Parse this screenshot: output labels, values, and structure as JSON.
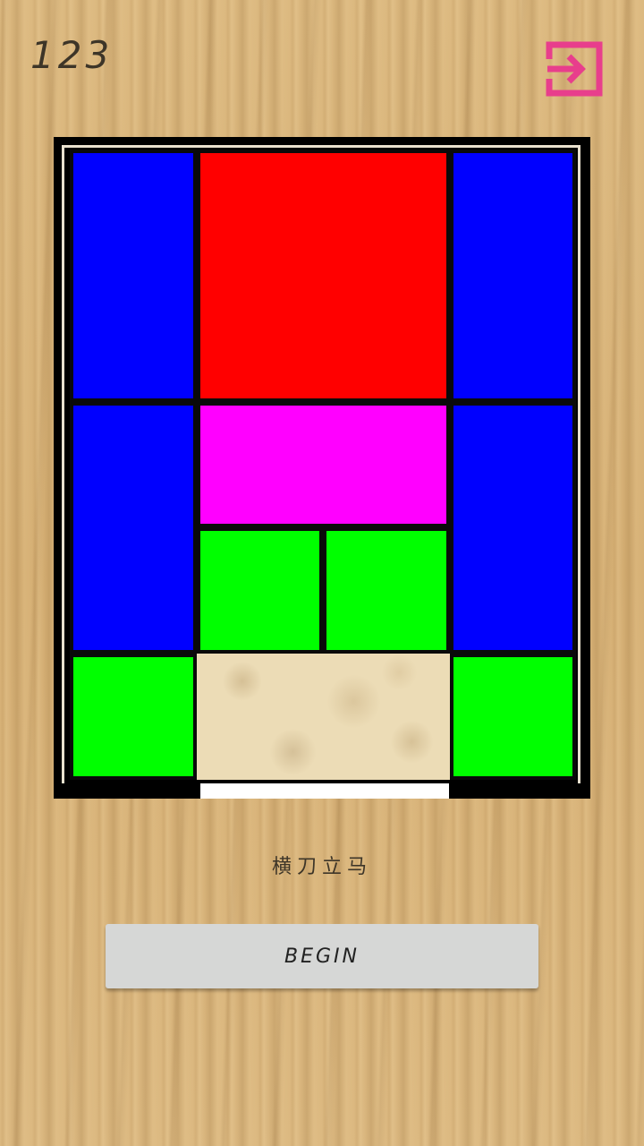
{
  "header": {
    "move_counter": "123",
    "exit_icon": "exit-icon",
    "exit_icon_color": "#e83e8c"
  },
  "board": {
    "columns": 4,
    "rows": 5,
    "frame_color": "#000000",
    "rim_color": "#e9e1cf",
    "pieces": [
      {
        "type": "vertical-2x1",
        "color": "#0000ff",
        "col": 0,
        "row": 0
      },
      {
        "type": "big-2x2",
        "color": "#ff0000",
        "col": 1,
        "row": 0
      },
      {
        "type": "vertical-2x1",
        "color": "#0000ff",
        "col": 3,
        "row": 0
      },
      {
        "type": "vertical-2x1",
        "color": "#0000ff",
        "col": 0,
        "row": 2
      },
      {
        "type": "horizontal-1x2",
        "color": "#ff00ff",
        "col": 1,
        "row": 2
      },
      {
        "type": "vertical-2x1",
        "color": "#0000ff",
        "col": 3,
        "row": 2
      },
      {
        "type": "small-1x1",
        "color": "#00ff00",
        "col": 1,
        "row": 3
      },
      {
        "type": "small-1x1",
        "color": "#00ff00",
        "col": 2,
        "row": 3
      },
      {
        "type": "small-1x1",
        "color": "#00ff00",
        "col": 0,
        "row": 4
      },
      {
        "type": "small-1x1",
        "color": "#00ff00",
        "col": 3,
        "row": 4
      }
    ],
    "empty_cells": [
      {
        "col": 1,
        "row": 4,
        "colspan": 2,
        "rowspan": 1
      }
    ]
  },
  "level": {
    "name": "横刀立马"
  },
  "actions": {
    "begin_label": "BEGIN"
  }
}
